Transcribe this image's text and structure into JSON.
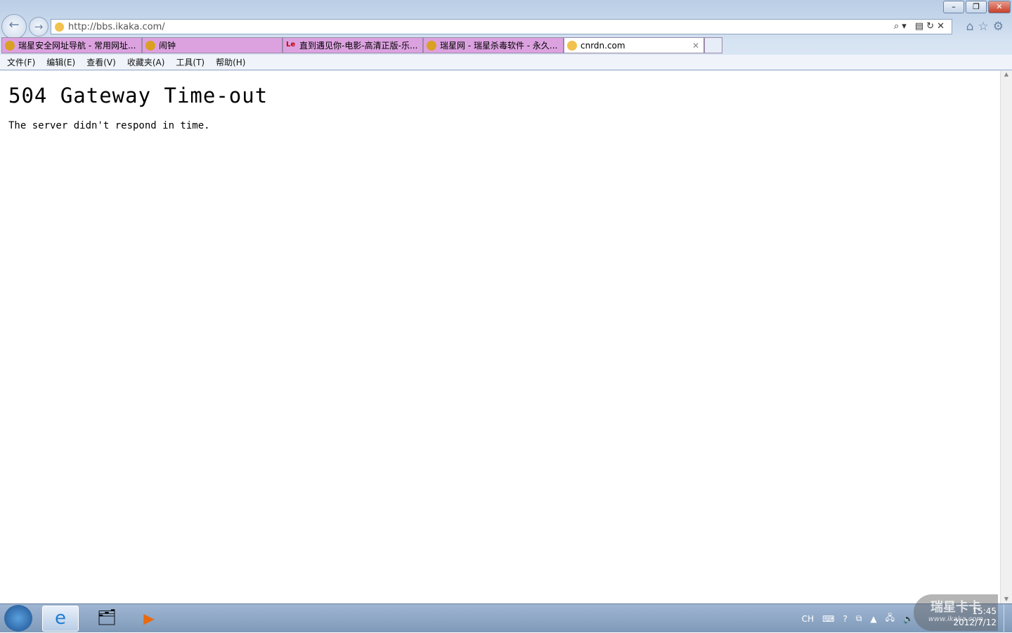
{
  "browser": {
    "address": "http://bbs.ikaka.com/",
    "tabs": [
      {
        "title": "瑞星安全网址导航 - 常用网址...",
        "icon": "rising-lion-icon"
      },
      {
        "title": "闹钟",
        "icon": "rising-lion-icon"
      },
      {
        "title": "直到遇见你-电影-高清正版-乐...",
        "icon": "le-icon",
        "icon_text": "Le"
      },
      {
        "title": "瑞星网 - 瑞星杀毒软件 - 永久...",
        "icon": "rising-lion-icon"
      },
      {
        "title": "cnrdn.com",
        "icon": "ie-page-icon",
        "active": true
      }
    ],
    "menu": [
      "文件(F)",
      "编辑(E)",
      "查看(V)",
      "收藏夹(A)",
      "工具(T)",
      "帮助(H)"
    ]
  },
  "page": {
    "heading": "504 Gateway Time-out",
    "message": "The server didn't respond in time."
  },
  "taskbar": {
    "tray_lang": "CH",
    "time": "15:45",
    "date": "2012/7/12",
    "watermark": {
      "title": "瑞星卡卡",
      "url": "www.ikaka.com"
    }
  },
  "colors": {
    "tab_inactive": "#dca2e0",
    "chrome": "#c8d8ec"
  }
}
